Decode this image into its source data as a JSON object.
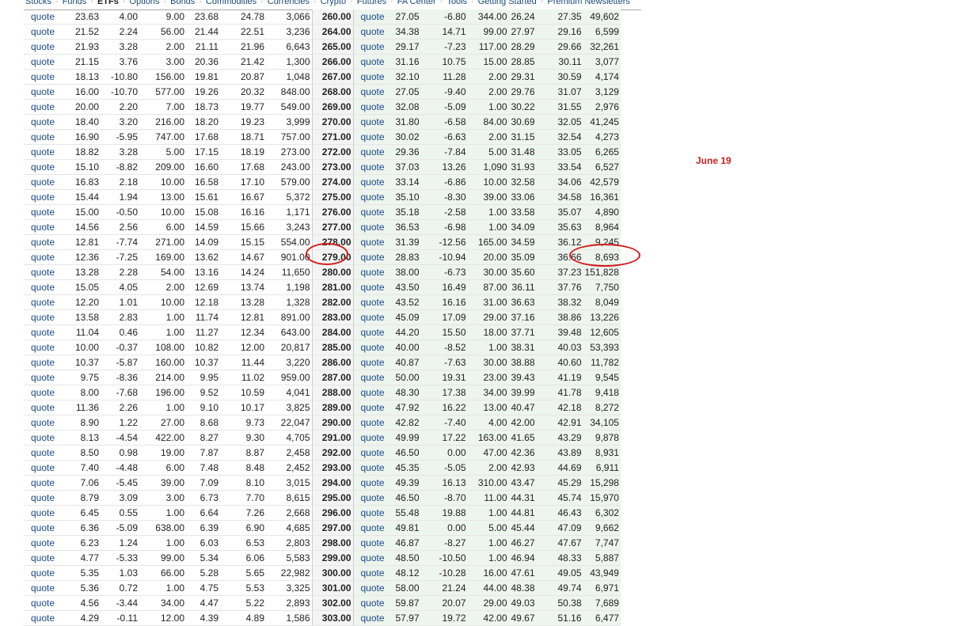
{
  "nav": {
    "items": [
      "Stocks",
      "Funds",
      "ETFs",
      "Options",
      "Bonds",
      "Commodities",
      "Currencies",
      "Crypto",
      "Futures",
      "FA Center",
      "Tools",
      "Getting Started",
      "Premium Newsletters"
    ],
    "active_index": 2
  },
  "annotation": {
    "label": "June 19"
  },
  "quote_label": "quote",
  "rows": [
    {
      "c": [
        "23.63",
        "4.00",
        "9.00",
        "23.68",
        "24.78",
        "3,066"
      ],
      "s": "260.00",
      "p": [
        "27.05",
        "-6.80",
        "344.00",
        "26.24",
        "27.35",
        "49,602"
      ]
    },
    {
      "c": [
        "21.52",
        "2.24",
        "56.00",
        "21.44",
        "22.51",
        "3,236"
      ],
      "s": "264.00",
      "p": [
        "34.38",
        "14.71",
        "99.00",
        "27.97",
        "29.16",
        "6,599"
      ]
    },
    {
      "c": [
        "21.93",
        "3.28",
        "2.00",
        "21.11",
        "21.96",
        "6,643"
      ],
      "s": "265.00",
      "p": [
        "29.17",
        "-7.23",
        "117.00",
        "28.29",
        "29.66",
        "32,261"
      ]
    },
    {
      "c": [
        "21.15",
        "3.76",
        "3.00",
        "20.36",
        "21.42",
        "1,300"
      ],
      "s": "266.00",
      "p": [
        "31.16",
        "10.75",
        "15.00",
        "28.85",
        "30.11",
        "3,077"
      ]
    },
    {
      "c": [
        "18.13",
        "-10.80",
        "156.00",
        "19.81",
        "20.87",
        "1,048"
      ],
      "s": "267.00",
      "p": [
        "32.10",
        "11.28",
        "2.00",
        "29.31",
        "30.59",
        "4,174"
      ]
    },
    {
      "c": [
        "16.00",
        "-10.70",
        "577.00",
        "19.26",
        "20.32",
        "848.00"
      ],
      "s": "268.00",
      "p": [
        "27.05",
        "-9.40",
        "2.00",
        "29.76",
        "31.07",
        "3,129"
      ]
    },
    {
      "c": [
        "20.00",
        "2.20",
        "7.00",
        "18.73",
        "19.77",
        "549.00"
      ],
      "s": "269.00",
      "p": [
        "32.08",
        "-5.09",
        "1.00",
        "30.22",
        "31.55",
        "2,976"
      ]
    },
    {
      "c": [
        "18.40",
        "3.20",
        "216.00",
        "18.20",
        "19.23",
        "3,999"
      ],
      "s": "270.00",
      "p": [
        "31.80",
        "-6.58",
        "84.00",
        "30.69",
        "32.05",
        "41,245"
      ]
    },
    {
      "c": [
        "16.90",
        "-5.95",
        "747.00",
        "17.68",
        "18.71",
        "757.00"
      ],
      "s": "271.00",
      "p": [
        "30.02",
        "-6.63",
        "2.00",
        "31.15",
        "32.54",
        "4,273"
      ]
    },
    {
      "c": [
        "18.82",
        "3.28",
        "5.00",
        "17.15",
        "18.19",
        "273.00"
      ],
      "s": "272.00",
      "p": [
        "29.36",
        "-7.84",
        "5.00",
        "31.48",
        "33.05",
        "6,265"
      ]
    },
    {
      "c": [
        "15.10",
        "-8.82",
        "209.00",
        "16.60",
        "17.68",
        "243.00"
      ],
      "s": "273.00",
      "p": [
        "37.03",
        "13.26",
        "1,090",
        "31.93",
        "33.54",
        "6,527"
      ]
    },
    {
      "c": [
        "16.83",
        "2.18",
        "10.00",
        "16.58",
        "17.10",
        "579.00"
      ],
      "s": "274.00",
      "p": [
        "33.14",
        "-6.86",
        "10.00",
        "32.58",
        "34.06",
        "42,579"
      ]
    },
    {
      "c": [
        "15.44",
        "1.94",
        "13.00",
        "15.61",
        "16.67",
        "5,372"
      ],
      "s": "275.00",
      "p": [
        "35.10",
        "-8.30",
        "39.00",
        "33.06",
        "34.58",
        "16,361"
      ]
    },
    {
      "c": [
        "15.00",
        "-0.50",
        "10.00",
        "15.08",
        "16.16",
        "1,171"
      ],
      "s": "276.00",
      "p": [
        "35.18",
        "-2.58",
        "1.00",
        "33.58",
        "35.07",
        "4,890"
      ]
    },
    {
      "c": [
        "14.56",
        "2.56",
        "6.00",
        "14.59",
        "15.66",
        "3,243"
      ],
      "s": "277.00",
      "p": [
        "36.53",
        "-6.98",
        "1.00",
        "34.09",
        "35.63",
        "8,964"
      ]
    },
    {
      "c": [
        "12.81",
        "-7.74",
        "271.00",
        "14.09",
        "15.15",
        "554.00"
      ],
      "s": "278.00",
      "p": [
        "31.39",
        "-12.56",
        "165.00",
        "34.59",
        "36.12",
        "9,245"
      ]
    },
    {
      "c": [
        "12.36",
        "-7.25",
        "169.00",
        "13.62",
        "14.67",
        "901.00"
      ],
      "s": "279.00",
      "p": [
        "28.83",
        "-10.94",
        "20.00",
        "35.09",
        "36.66",
        "8,693"
      ]
    },
    {
      "c": [
        "13.28",
        "2.28",
        "54.00",
        "13.16",
        "14.24",
        "11,650"
      ],
      "s": "280.00",
      "p": [
        "38.00",
        "-6.73",
        "30.00",
        "35.60",
        "37.23",
        "151,828"
      ]
    },
    {
      "c": [
        "15.05",
        "4.05",
        "2.00",
        "12.69",
        "13.74",
        "1,198"
      ],
      "s": "281.00",
      "p": [
        "43.50",
        "16.49",
        "87.00",
        "36.11",
        "37.76",
        "7,750"
      ]
    },
    {
      "c": [
        "12.20",
        "1.01",
        "10.00",
        "12.18",
        "13.28",
        "1,328"
      ],
      "s": "282.00",
      "p": [
        "43.52",
        "16.16",
        "31.00",
        "36.63",
        "38.32",
        "8,049"
      ]
    },
    {
      "c": [
        "13.58",
        "2.83",
        "1.00",
        "11.74",
        "12.81",
        "891.00"
      ],
      "s": "283.00",
      "p": [
        "45.09",
        "17.09",
        "29.00",
        "37.16",
        "38.86",
        "13,226"
      ]
    },
    {
      "c": [
        "11.04",
        "0.46",
        "1.00",
        "11.27",
        "12.34",
        "643.00"
      ],
      "s": "284.00",
      "p": [
        "44.20",
        "15.50",
        "18.00",
        "37.71",
        "39.48",
        "12,605"
      ]
    },
    {
      "c": [
        "10.00",
        "-0.37",
        "108.00",
        "10.82",
        "12.00",
        "20,817"
      ],
      "s": "285.00",
      "p": [
        "40.00",
        "-8.52",
        "1.00",
        "38.31",
        "40.03",
        "53,393"
      ]
    },
    {
      "c": [
        "10.37",
        "-5.87",
        "160.00",
        "10.37",
        "11.44",
        "3,220"
      ],
      "s": "286.00",
      "p": [
        "40.87",
        "-7.63",
        "30.00",
        "38.88",
        "40.60",
        "11,782"
      ]
    },
    {
      "c": [
        "9.75",
        "-8.36",
        "214.00",
        "9.95",
        "11.02",
        "959.00"
      ],
      "s": "287.00",
      "p": [
        "50.00",
        "19.31",
        "23.00",
        "39.43",
        "41.19",
        "9,545"
      ]
    },
    {
      "c": [
        "8.00",
        "-7.68",
        "196.00",
        "9.52",
        "10.59",
        "4,041"
      ],
      "s": "288.00",
      "p": [
        "48.30",
        "17.38",
        "34.00",
        "39.99",
        "41.78",
        "9,418"
      ]
    },
    {
      "c": [
        "11.36",
        "2.26",
        "1.00",
        "9.10",
        "10.17",
        "3,825"
      ],
      "s": "289.00",
      "p": [
        "47.92",
        "16.22",
        "13.00",
        "40.47",
        "42.18",
        "8,272"
      ]
    },
    {
      "c": [
        "8.90",
        "1.22",
        "27.00",
        "8.68",
        "9.73",
        "22,047"
      ],
      "s": "290.00",
      "p": [
        "42.82",
        "-7.40",
        "4.00",
        "42.00",
        "42.91",
        "34,105"
      ]
    },
    {
      "c": [
        "8.13",
        "-4.54",
        "422.00",
        "8.27",
        "9.30",
        "4,705"
      ],
      "s": "291.00",
      "p": [
        "49.99",
        "17.22",
        "163.00",
        "41.65",
        "43.29",
        "9,878"
      ]
    },
    {
      "c": [
        "8.50",
        "0.98",
        "19.00",
        "7.87",
        "8.87",
        "2,458"
      ],
      "s": "292.00",
      "p": [
        "46.50",
        "0.00",
        "47.00",
        "42.36",
        "43.89",
        "8,931"
      ]
    },
    {
      "c": [
        "7.40",
        "-4.48",
        "6.00",
        "7.48",
        "8.48",
        "2,452"
      ],
      "s": "293.00",
      "p": [
        "45.35",
        "-5.05",
        "2.00",
        "42.93",
        "44.69",
        "6,911"
      ]
    },
    {
      "c": [
        "7.06",
        "-5.45",
        "39.00",
        "7.09",
        "8.10",
        "3,015"
      ],
      "s": "294.00",
      "p": [
        "49.39",
        "16.13",
        "310.00",
        "43.47",
        "45.29",
        "15,298"
      ]
    },
    {
      "c": [
        "8.79",
        "3.09",
        "3.00",
        "6.73",
        "7.70",
        "8,615"
      ],
      "s": "295.00",
      "p": [
        "46.50",
        "-8.70",
        "11.00",
        "44.31",
        "45.74",
        "15,970"
      ]
    },
    {
      "c": [
        "6.45",
        "0.55",
        "1.00",
        "6.64",
        "7.26",
        "2,668"
      ],
      "s": "296.00",
      "p": [
        "55.48",
        "19.88",
        "1.00",
        "44.81",
        "46.43",
        "6,302"
      ]
    },
    {
      "c": [
        "6.36",
        "-5.09",
        "638.00",
        "6.39",
        "6.90",
        "4,685"
      ],
      "s": "297.00",
      "p": [
        "49.81",
        "0.00",
        "5.00",
        "45.44",
        "47.09",
        "9,662"
      ]
    },
    {
      "c": [
        "6.23",
        "1.24",
        "1.00",
        "6.03",
        "6.53",
        "2,803"
      ],
      "s": "298.00",
      "p": [
        "46.87",
        "-8.27",
        "1.00",
        "46.27",
        "47.67",
        "7,747"
      ]
    },
    {
      "c": [
        "4.77",
        "-5.33",
        "99.00",
        "5.34",
        "6.06",
        "5,583"
      ],
      "s": "299.00",
      "p": [
        "48.50",
        "-10.50",
        "1.00",
        "46.94",
        "48.33",
        "5,887"
      ]
    },
    {
      "c": [
        "5.35",
        "1.03",
        "66.00",
        "5.28",
        "5.65",
        "22,982"
      ],
      "s": "300.00",
      "p": [
        "48.12",
        "-10.28",
        "16.00",
        "47.61",
        "49.05",
        "43,949"
      ]
    },
    {
      "c": [
        "5.36",
        "0.72",
        "1.00",
        "4.75",
        "5.53",
        "3,325"
      ],
      "s": "301.00",
      "p": [
        "58.00",
        "21.24",
        "44.00",
        "48.38",
        "49.74",
        "6,971"
      ]
    },
    {
      "c": [
        "4.56",
        "-3.44",
        "34.00",
        "4.47",
        "5.22",
        "2,893"
      ],
      "s": "302.00",
      "p": [
        "59.87",
        "20.07",
        "29.00",
        "49.03",
        "50.38",
        "7,689"
      ]
    },
    {
      "c": [
        "4.29",
        "-0.11",
        "12.00",
        "4.39",
        "4.89",
        "1,586"
      ],
      "s": "303.00",
      "p": [
        "57.97",
        "19.72",
        "42.00",
        "49.67",
        "51.16",
        "6,477"
      ]
    }
  ]
}
